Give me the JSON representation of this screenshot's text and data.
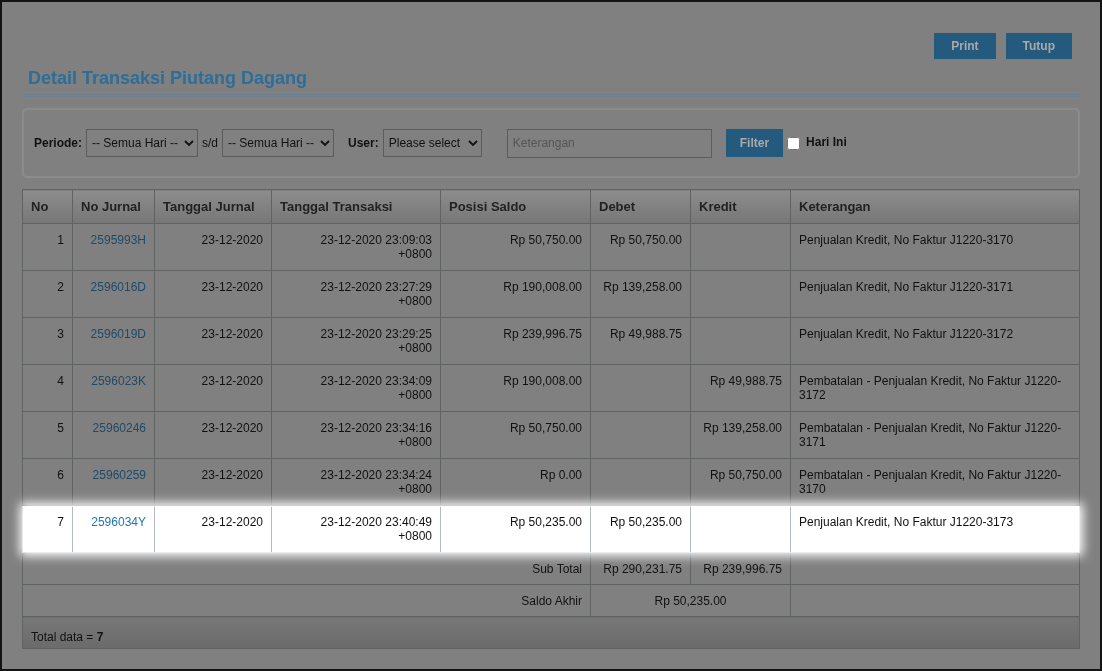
{
  "toolbar": {
    "buttons": [
      "Print",
      "Tutup"
    ]
  },
  "title": "Detail Transaksi Piutang Dagang",
  "filters": {
    "periode_label": "Periode:",
    "periode_from": "-- Semua Hari --",
    "separator": "s/d",
    "periode_to": "-- Semua Hari --",
    "user_label": "User:",
    "user": "Please select",
    "keterangan": {
      "placeholder": "Keterangan"
    },
    "filter_button": "Filter",
    "hari_ini": {
      "label": "Hari Ini",
      "checked": false
    }
  },
  "table": {
    "columns": [
      "No",
      "No Jurnal",
      "Tanggal Jurnal",
      "Tanggal Transaksi",
      "Posisi Saldo",
      "Debet",
      "Kredit",
      "Keterangan"
    ],
    "rows": [
      {
        "no": "1",
        "no_jurnal": "2595993H",
        "tanggal_jurnal": "23-12-2020",
        "tanggal_transaksi": "23-12-2020 23:09:03 +0800",
        "posisi_saldo": "Rp 50,750.00",
        "debet": "Rp 50,750.00",
        "kredit": "",
        "keterangan": "Penjualan Kredit, No Faktur J1220-3170",
        "highlighted": false
      },
      {
        "no": "2",
        "no_jurnal": "2596016D",
        "tanggal_jurnal": "23-12-2020",
        "tanggal_transaksi": "23-12-2020 23:27:29 +0800",
        "posisi_saldo": "Rp 190,008.00",
        "debet": "Rp 139,258.00",
        "kredit": "",
        "keterangan": "Penjualan Kredit, No Faktur J1220-3171",
        "highlighted": false
      },
      {
        "no": "3",
        "no_jurnal": "2596019D",
        "tanggal_jurnal": "23-12-2020",
        "tanggal_transaksi": "23-12-2020 23:29:25 +0800",
        "posisi_saldo": "Rp 239,996.75",
        "debet": "Rp 49,988.75",
        "kredit": "",
        "keterangan": "Penjualan Kredit, No Faktur J1220-3172",
        "highlighted": false
      },
      {
        "no": "4",
        "no_jurnal": "2596023K",
        "tanggal_jurnal": "23-12-2020",
        "tanggal_transaksi": "23-12-2020 23:34:09 +0800",
        "posisi_saldo": "Rp 190,008.00",
        "debet": "",
        "kredit": "Rp 49,988.75",
        "keterangan": "Pembatalan - Penjualan Kredit, No Faktur J1220-3172",
        "highlighted": false
      },
      {
        "no": "5",
        "no_jurnal": "25960246",
        "tanggal_jurnal": "23-12-2020",
        "tanggal_transaksi": "23-12-2020 23:34:16 +0800",
        "posisi_saldo": "Rp 50,750.00",
        "debet": "",
        "kredit": "Rp 139,258.00",
        "keterangan": "Pembatalan - Penjualan Kredit, No Faktur J1220-3171",
        "highlighted": false
      },
      {
        "no": "6",
        "no_jurnal": "25960259",
        "tanggal_jurnal": "23-12-2020",
        "tanggal_transaksi": "23-12-2020 23:34:24 +0800",
        "posisi_saldo": "Rp 0.00",
        "debet": "",
        "kredit": "Rp 50,750.00",
        "keterangan": "Pembatalan - Penjualan Kredit, No Faktur J1220-3170",
        "highlighted": false
      },
      {
        "no": "7",
        "no_jurnal": "2596034Y",
        "tanggal_jurnal": "23-12-2020",
        "tanggal_transaksi": "23-12-2020 23:40:49 +0800",
        "posisi_saldo": "Rp 50,235.00",
        "debet": "Rp 50,235.00",
        "kredit": "",
        "keterangan": "Penjualan Kredit, No Faktur J1220-3173",
        "highlighted": true
      }
    ],
    "sub_total": {
      "label": "Sub Total",
      "debet": "Rp 290,231.75",
      "kredit": "Rp 239,996.75"
    },
    "saldo_akhir": {
      "label": "Saldo Akhir",
      "value": "Rp 50,235.00"
    },
    "total": {
      "label": "Total data =",
      "value": "7"
    }
  }
}
